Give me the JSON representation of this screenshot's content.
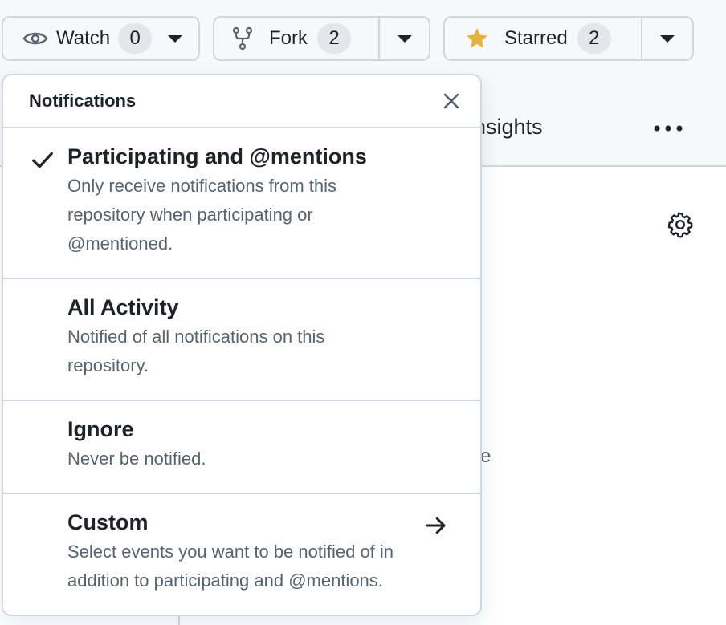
{
  "toolbar": {
    "watch": {
      "label": "Watch",
      "count": "0"
    },
    "fork": {
      "label": "Fork",
      "count": "2"
    },
    "star": {
      "label": "Starred",
      "count": "2"
    }
  },
  "background": {
    "tab_label": "nsights",
    "stray_text": "e"
  },
  "notifications": {
    "title": "Notifications",
    "options": [
      {
        "title": "Participating and @mentions",
        "description": "Only receive notifications from this repository when participating or @mentioned.",
        "selected": true
      },
      {
        "title": "All Activity",
        "description": "Notified of all notifications on this repository.",
        "selected": false
      },
      {
        "title": "Ignore",
        "description": "Never be notified.",
        "selected": false
      },
      {
        "title": "Custom",
        "description": "Select events you want to be notified of in addition to participating and @mentions.",
        "selected": false
      }
    ]
  },
  "colors": {
    "star": "#e3b341",
    "border": "#d0d7de",
    "muted_text": "#59636e"
  }
}
